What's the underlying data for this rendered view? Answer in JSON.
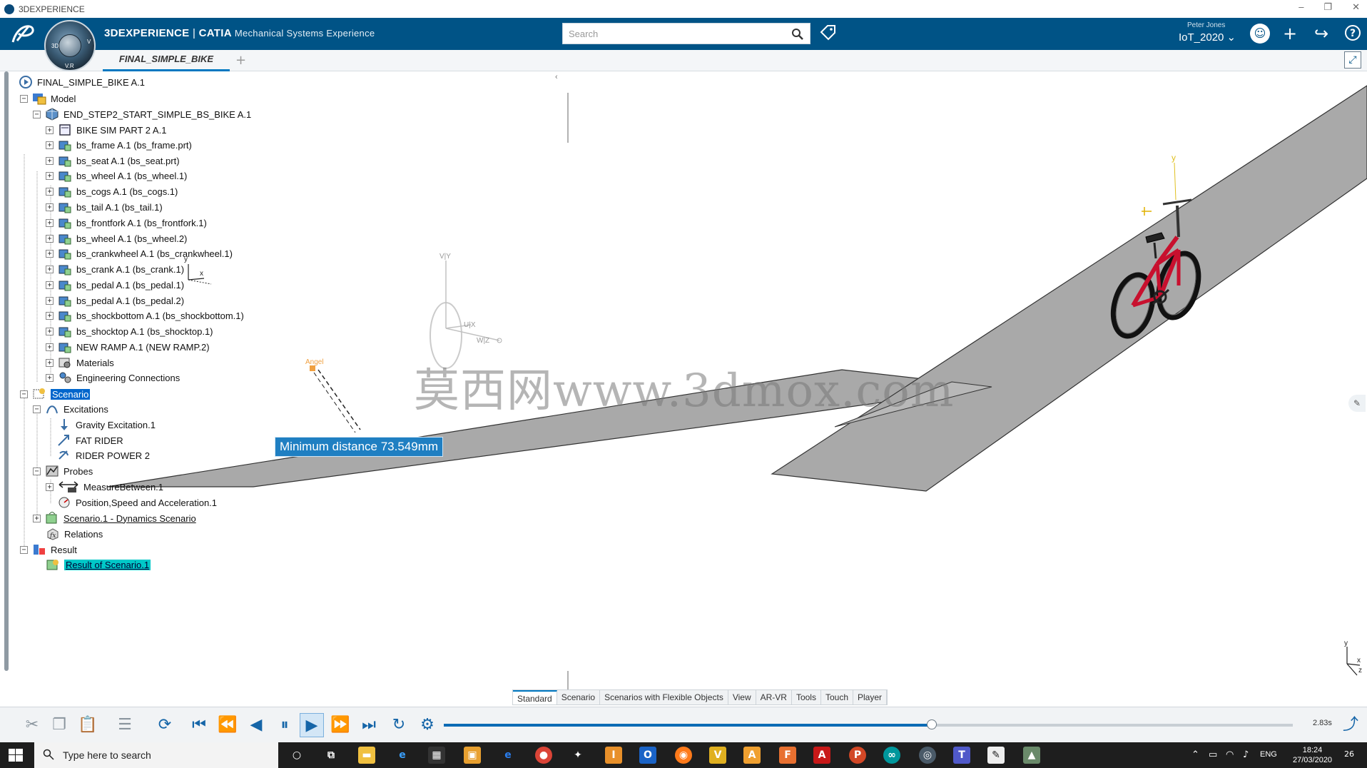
{
  "window": {
    "title": "3DEXPERIENCE",
    "controls": [
      "–",
      "❐",
      "✕"
    ]
  },
  "header": {
    "brand_bold": "3DEXPERIENCE",
    "brand_sep": " | ",
    "brand_app": "CATIA",
    "brand_sub": "Mechanical Systems Experience",
    "search_placeholder": "Search",
    "user_name": "Peter Jones",
    "collab_space": "IoT_2020 ⌄",
    "compass_labels": {
      "top": "3D",
      "right": "V",
      "bottom": "V.R"
    }
  },
  "tabs": {
    "active": "FINAL_SIMPLE_BIKE",
    "add": "+"
  },
  "tree": {
    "root": "FINAL_SIMPLE_BIKE A.1",
    "model": "Model",
    "product": "END_STEP2_START_SIMPLE_BS_BIKE A.1",
    "parts": [
      "BIKE SIM PART 2 A.1",
      "bs_frame A.1 (bs_frame.prt)",
      "bs_seat A.1 (bs_seat.prt)",
      "bs_wheel A.1 (bs_wheel.1)",
      "bs_cogs A.1 (bs_cogs.1)",
      "bs_tail A.1 (bs_tail.1)",
      "bs_frontfork A.1 (bs_frontfork.1)",
      "bs_wheel A.1 (bs_wheel.2)",
      "bs_crankwheel A.1 (bs_crankwheel.1)",
      "bs_crank A.1 (bs_crank.1)",
      "bs_pedal A.1 (bs_pedal.1)",
      "bs_pedal A.1 (bs_pedal.2)",
      "bs_shockbottom A.1 (bs_shockbottom.1)",
      "bs_shocktop A.1 (bs_shocktop.1)",
      "NEW RAMP A.1 (NEW RAMP.2)",
      "Materials",
      "Engineering Connections"
    ],
    "scenario": "Scenario",
    "excitations": "Excitations",
    "excitation_items": [
      "Gravity Excitation.1",
      "FAT RIDER",
      "RIDER POWER 2"
    ],
    "probes": "Probes",
    "probe_items": [
      "MeasureBetween.1",
      "Position,Speed and Acceleration.1"
    ],
    "dynamics_scenario": "Scenario.1 - Dynamics Scenario",
    "relations": "Relations",
    "result": "Result",
    "result_item": "Result of Scenario.1",
    "expand_plus": "+",
    "expand_minus": "−",
    "collapse_panel": "‹"
  },
  "viewport": {
    "min_distance_label": "Minimum distance 73.549mm",
    "watermark": "莫西网www.3dmox.com",
    "robot_axes": {
      "v": "V|Y",
      "u": "U|X",
      "w": "W|Z"
    },
    "bike_axis": "y",
    "corner_axes": {
      "y": "y",
      "x": "x",
      "z": "z"
    },
    "small_axis": {
      "y": "y",
      "x": "x"
    },
    "angle_label": "Angel"
  },
  "workbench_tabs": [
    "Standard",
    "Scenario",
    "Scenarios with Flexible Objects",
    "View",
    "AR-VR",
    "Tools",
    "Touch",
    "Player"
  ],
  "player": {
    "progress": 0.575,
    "time": "2.83s"
  },
  "taskbar": {
    "search_placeholder": "Type here to search",
    "lang": "ENG",
    "time": "18:24",
    "date": "27/03/2020",
    "notifications": "26"
  },
  "colors": {
    "header": "#005386",
    "accent": "#0078c1",
    "selection": "#0066cc",
    "result_highlight": "#00c8c8",
    "bike": "#c8102e"
  }
}
